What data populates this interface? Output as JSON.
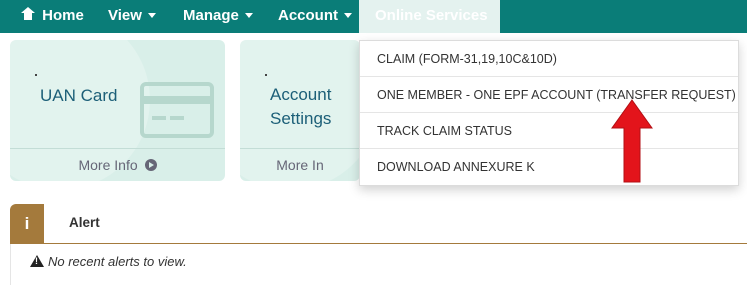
{
  "nav": {
    "home": "Home",
    "view": "View",
    "manage": "Manage",
    "account": "Account",
    "online_services": "Online Services"
  },
  "cards": {
    "uan": {
      "title": "UAN Card",
      "more_info": "More Info"
    },
    "account_settings": {
      "title_line1": "Account",
      "title_line2": "Settings",
      "more_info": "More In"
    }
  },
  "dropdown": {
    "items": [
      "CLAIM (FORM-31,19,10C&10D)",
      "ONE MEMBER - ONE EPF ACCOUNT (TRANSFER REQUEST)",
      "TRACK CLAIM STATUS",
      "DOWNLOAD ANNEXURE K"
    ]
  },
  "alert": {
    "badge": "i",
    "title": "Alert",
    "message": "No recent alerts to view."
  },
  "colors": {
    "nav_bg": "#0a7d78",
    "card_bg": "#d9efe9",
    "alert_accent": "#a47a3c",
    "arrow": "#e3141b"
  },
  "icons": [
    "home-icon",
    "caret-down-icon",
    "chevron-circle-right-icon",
    "id-card-icon",
    "info-icon",
    "warning-icon",
    "red-arrow-annotation"
  ]
}
